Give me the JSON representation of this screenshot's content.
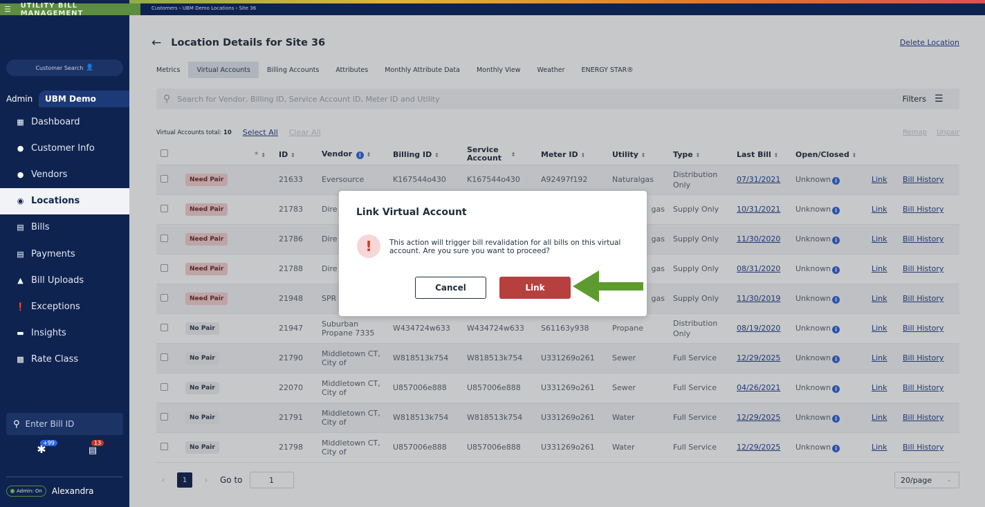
{
  "brand": "UTILITY BILL MANAGEMENT",
  "breadcrumb": "Customers › UBM Demo Locations › Site 36",
  "sidebar": {
    "customer_search": "Customer Search",
    "admin_label": "Admin",
    "org_name": "UBM Demo",
    "items": [
      {
        "label": "Dashboard",
        "icon": "dashboard-icon"
      },
      {
        "label": "Customer Info",
        "icon": "person-icon"
      },
      {
        "label": "Vendors",
        "icon": "vendor-icon"
      },
      {
        "label": "Locations",
        "icon": "location-pin-icon"
      },
      {
        "label": "Bills",
        "icon": "bill-icon"
      },
      {
        "label": "Payments",
        "icon": "payment-icon"
      },
      {
        "label": "Bill Uploads",
        "icon": "upload-icon"
      },
      {
        "label": "Exceptions",
        "icon": "exclamation-icon"
      },
      {
        "label": "Insights",
        "icon": "chat-icon"
      },
      {
        "label": "Rate Class",
        "icon": "rate-icon"
      }
    ],
    "bill_id_placeholder": "Enter Bill ID",
    "badge_asterisk": "+99",
    "badge_bills": "13",
    "admin_status": "Admin: On",
    "user_name": "Alexandra"
  },
  "page": {
    "title": "Location Details for Site 36",
    "delete_label": "Delete Location",
    "tabs": [
      "Metrics",
      "Virtual Accounts",
      "Billing Accounts",
      "Attributes",
      "Monthly Attribute Data",
      "Monthly View",
      "Weather",
      "ENERGY STAR®"
    ],
    "search_placeholder": "Search for Vendor, Billing ID, Service Account ID, Meter ID and Utility",
    "filters_label": "Filters",
    "totals_label": "Virtual Accounts total:",
    "totals_count": "10",
    "select_all": "Select All",
    "clear_all": "Clear All",
    "remap": "Remap",
    "unpair": "Unpair"
  },
  "table": {
    "headers": {
      "star": "*",
      "id": "ID",
      "vendor": "Vendor",
      "billing_id": "Billing ID",
      "service_account": "Service Account",
      "meter_id": "Meter ID",
      "utility": "Utility",
      "type": "Type",
      "last_bill": "Last Bill",
      "open_closed": "Open/Closed"
    },
    "rows": [
      {
        "pair": "Need Pair",
        "id": "21633",
        "vendor": "Eversource",
        "billing_id": "K167544o430",
        "service_account": "K167544o430",
        "meter_id": "A92497f192",
        "utility": "Naturalgas",
        "type": "Distribution Only",
        "last_bill": "07/31/2021",
        "status": "Unknown",
        "link": "Link",
        "history": "Bill History"
      },
      {
        "pair": "Need Pair",
        "id": "21783",
        "vendor": "Dire",
        "billing_id": "",
        "service_account": "",
        "meter_id": "",
        "utility": "gas",
        "type": "Supply Only",
        "last_bill": "10/31/2021",
        "status": "Unknown",
        "link": "Link",
        "history": "Bill History"
      },
      {
        "pair": "Need Pair",
        "id": "21786",
        "vendor": "Dire",
        "billing_id": "",
        "service_account": "",
        "meter_id": "",
        "utility": "gas",
        "type": "Supply Only",
        "last_bill": "11/30/2020",
        "status": "Unknown",
        "link": "Link",
        "history": "Bill History"
      },
      {
        "pair": "Need Pair",
        "id": "21788",
        "vendor": "Dire",
        "billing_id": "",
        "service_account": "",
        "meter_id": "",
        "utility": "gas",
        "type": "Supply Only",
        "last_bill": "08/31/2020",
        "status": "Unknown",
        "link": "Link",
        "history": "Bill History"
      },
      {
        "pair": "Need Pair",
        "id": "21948",
        "vendor": "SPR",
        "billing_id": "",
        "service_account": "",
        "meter_id": "",
        "utility": "gas",
        "type": "Supply Only",
        "last_bill": "11/30/2019",
        "status": "Unknown",
        "link": "Link",
        "history": "Bill History"
      },
      {
        "pair": "No Pair",
        "id": "21947",
        "vendor": "Suburban Propane 7335",
        "billing_id": "W434724w633",
        "service_account": "W434724w633",
        "meter_id": "S61163y938",
        "utility": "Propane",
        "type": "Distribution Only",
        "last_bill": "08/19/2020",
        "status": "Unknown",
        "link": "Link",
        "history": "Bill History"
      },
      {
        "pair": "No Pair",
        "id": "21790",
        "vendor": "Middletown CT, City of",
        "billing_id": "W818513k754",
        "service_account": "W818513k754",
        "meter_id": "U331269o261",
        "utility": "Sewer",
        "type": "Full Service",
        "last_bill": "12/29/2025",
        "status": "Unknown",
        "link": "Link",
        "history": "Bill History"
      },
      {
        "pair": "No Pair",
        "id": "22070",
        "vendor": "Middletown CT, City of",
        "billing_id": "U857006e888",
        "service_account": "U857006e888",
        "meter_id": "U331269o261",
        "utility": "Sewer",
        "type": "Full Service",
        "last_bill": "04/26/2021",
        "status": "Unknown",
        "link": "Link",
        "history": "Bill History"
      },
      {
        "pair": "No Pair",
        "id": "21791",
        "vendor": "Middletown CT, City of",
        "billing_id": "W818513k754",
        "service_account": "W818513k754",
        "meter_id": "U331269o261",
        "utility": "Water",
        "type": "Full Service",
        "last_bill": "12/29/2025",
        "status": "Unknown",
        "link": "Link",
        "history": "Bill History"
      },
      {
        "pair": "No Pair",
        "id": "21798",
        "vendor": "Middletown CT, City of",
        "billing_id": "U857006e888",
        "service_account": "U857006e888",
        "meter_id": "U331269o261",
        "utility": "Water",
        "type": "Full Service",
        "last_bill": "12/29/2025",
        "status": "Unknown",
        "link": "Link",
        "history": "Bill History"
      }
    ]
  },
  "pager": {
    "current": "1",
    "goto_label": "Go to",
    "goto_value": "1",
    "per_page": "20/page"
  },
  "modal": {
    "title": "Link Virtual Account",
    "message": "This action will trigger bill revalidation for all bills on this virtual account. Are you sure you want to proceed?",
    "cancel": "Cancel",
    "confirm": "Link"
  },
  "colors": {
    "sidebar": "#0f2350",
    "brand": "#5d8d3f",
    "danger": "#b5403e",
    "arrow": "#5e9b2f",
    "link": "#1f3f8c"
  }
}
